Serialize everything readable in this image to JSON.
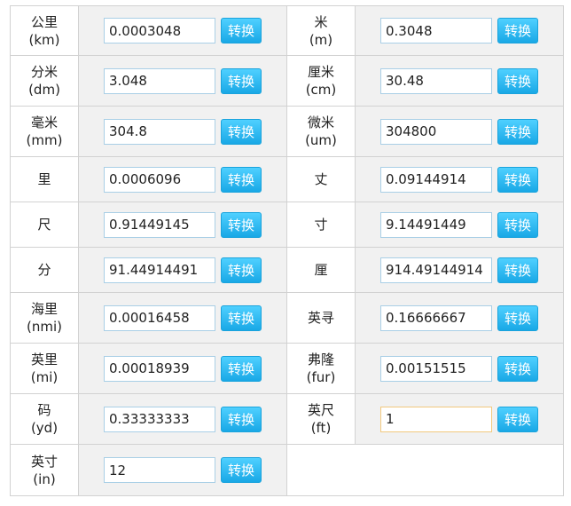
{
  "button_label": "转换",
  "accent_color": "#1aa8e6",
  "units": [
    {
      "name": "公里",
      "unit": "(km)",
      "value": "0.0003048"
    },
    {
      "name": "米",
      "unit": "(m)",
      "value": "0.3048"
    },
    {
      "name": "分米",
      "unit": "(dm)",
      "value": "3.048"
    },
    {
      "name": "厘米",
      "unit": "(cm)",
      "value": "30.48"
    },
    {
      "name": "毫米",
      "unit": "(mm)",
      "value": "304.8"
    },
    {
      "name": "微米",
      "unit": "(um)",
      "value": "304800"
    },
    {
      "name": "里",
      "unit": "",
      "value": "0.0006096"
    },
    {
      "name": "丈",
      "unit": "",
      "value": "0.09144914"
    },
    {
      "name": "尺",
      "unit": "",
      "value": "0.91449145"
    },
    {
      "name": "寸",
      "unit": "",
      "value": "9.14491449"
    },
    {
      "name": "分",
      "unit": "",
      "value": "91.44914491"
    },
    {
      "name": "厘",
      "unit": "",
      "value": "914.49144914"
    },
    {
      "name": "海里",
      "unit": "(nmi)",
      "value": "0.00016458"
    },
    {
      "name": "英寻",
      "unit": "",
      "value": "0.16666667"
    },
    {
      "name": "英里",
      "unit": "(mi)",
      "value": "0.00018939"
    },
    {
      "name": "弗隆",
      "unit": "(fur)",
      "value": "0.00151515"
    },
    {
      "name": "码",
      "unit": "(yd)",
      "value": "0.33333333"
    },
    {
      "name": "英尺",
      "unit": "(ft)",
      "value": "1"
    },
    {
      "name": "英寸",
      "unit": "(in)",
      "value": "12"
    }
  ]
}
